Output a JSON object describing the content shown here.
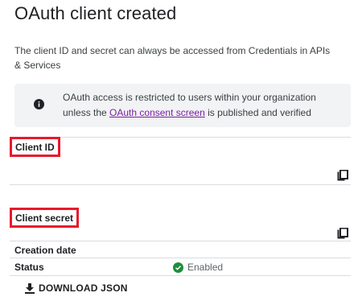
{
  "dialog": {
    "title": "OAuth client created",
    "description": "The client ID and secret can always be accessed from Credentials in APIs & Services"
  },
  "notice": {
    "icon": "info-icon",
    "text_before": "OAuth access is restricted to users within your organization unless the ",
    "link_text": "OAuth consent screen",
    "text_after": " is published and verified"
  },
  "fields": {
    "client_id_label": "Client ID",
    "client_id_value": "",
    "client_secret_label": "Client secret",
    "client_secret_value": "",
    "creation_date_label": "Creation date",
    "creation_date_value": "",
    "status_label": "Status",
    "status_value": "Enabled"
  },
  "actions": {
    "download_label": "DOWNLOAD JSON"
  },
  "colors": {
    "highlight_border": "#e8192c",
    "link": "#7b1fa2",
    "enabled": "#1e8e3e",
    "notice_bg": "#f1f3f4"
  }
}
